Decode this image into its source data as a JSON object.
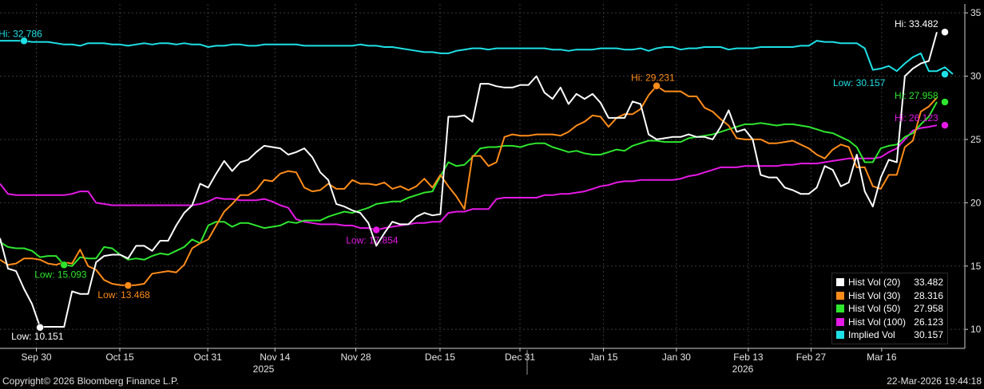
{
  "chart_data": {
    "type": "line",
    "x_ticks": [
      "Sep 30",
      "Oct 15",
      "Oct 31",
      "Nov 14",
      "Nov 28",
      "Dec 15",
      "Dec 31",
      "Jan 15",
      "Jan 30",
      "Feb 13",
      "Feb 27",
      "Mar 16"
    ],
    "x_years": [
      "2025",
      "2026"
    ],
    "y_ticks": [
      "10",
      "15",
      "20",
      "25",
      "30",
      "35"
    ],
    "ylim": [
      8.5,
      35.7
    ],
    "x_range": [
      0,
      118
    ],
    "grid": true,
    "legend_position": "bottom-right",
    "series": [
      {
        "name": "Hist Vol (20)",
        "color": "#ffffff",
        "last": "33.482",
        "values": [
          17.2,
          14.8,
          14.6,
          13.2,
          12.0,
          10.2,
          10.2,
          10.2,
          10.2,
          13.0,
          12.8,
          12.8,
          15.3,
          15.8,
          15.9,
          15.9,
          15.6,
          16.6,
          16.6,
          16.2,
          17.0,
          17.0,
          18.2,
          19.2,
          19.8,
          21.5,
          21.2,
          22.3,
          23.3,
          22.5,
          23.2,
          23.4,
          24.0,
          24.5,
          24.4,
          24.3,
          23.8,
          24.0,
          24.3,
          23.6,
          22.4,
          21.8,
          19.9,
          19.7,
          19.4,
          19.2,
          18.4,
          16.6,
          17.6,
          18.5,
          18.3,
          18.3,
          18.9,
          19.2,
          19.0,
          19.1,
          26.8,
          26.8,
          26.9,
          26.4,
          29.4,
          29.4,
          29.2,
          29.1,
          29.1,
          29.3,
          29.3,
          30.0,
          28.7,
          28.2,
          29.1,
          27.8,
          28.6,
          28.2,
          28.6,
          27.9,
          26.7,
          26.7,
          26.7,
          28.0,
          27.8,
          25.4,
          25.0,
          25.1,
          25.2,
          25.2,
          25.4,
          25.2,
          25.2,
          25.0,
          26.0,
          27.3,
          25.6,
          25.8,
          25.0,
          22.2,
          22.0,
          22.0,
          21.2,
          21.0,
          20.7,
          20.7,
          21.2,
          22.9,
          22.6,
          21.3,
          21.6,
          23.8,
          20.9,
          19.7,
          22.0,
          23.4,
          23.2,
          30.0,
          30.6,
          31.0,
          31.2,
          33.48
        ]
      },
      {
        "name": "Hist Vol (30)",
        "color": "#ff8c1a",
        "last": "28.316",
        "values": [
          15.5,
          15.1,
          15.2,
          15.6,
          15.6,
          15.5,
          15.2,
          15.1,
          15.3,
          15.2,
          16.3,
          15.0,
          14.7,
          13.9,
          13.6,
          13.5,
          13.47,
          13.5,
          13.6,
          14.4,
          14.5,
          14.6,
          14.5,
          15.1,
          16.4,
          16.8,
          17.1,
          18.2,
          19.3,
          19.9,
          20.6,
          20.6,
          21.0,
          21.8,
          21.7,
          22.3,
          22.5,
          22.4,
          21.2,
          20.9,
          21.0,
          21.5,
          21.1,
          21.1,
          21.8,
          21.5,
          21.5,
          21.4,
          21.6,
          21.1,
          21.3,
          21.0,
          21.3,
          21.9,
          21.2,
          22.2,
          21.3,
          20.5,
          19.5,
          23.7,
          23.7,
          22.9,
          23.2,
          25.2,
          25.4,
          25.3,
          25.3,
          25.4,
          25.4,
          25.4,
          25.3,
          25.6,
          26.1,
          26.4,
          26.9,
          26.8,
          26.0,
          26.7,
          27.0,
          27.0,
          27.4,
          28.5,
          29.23,
          28.8,
          28.8,
          28.8,
          28.4,
          28.4,
          27.5,
          27.2,
          26.6,
          26.1,
          25.1,
          25.0,
          25.0,
          25.0,
          24.7,
          24.7,
          24.8,
          24.9,
          24.6,
          24.3,
          23.8,
          23.5,
          24.2,
          24.6,
          24.4,
          22.8,
          22.8,
          21.3,
          21.1,
          22.2,
          22.2,
          24.4,
          24.9,
          27.2,
          27.6,
          28.3
        ]
      },
      {
        "name": "Hist Vol (50)",
        "color": "#2ee62e",
        "last": "27.958",
        "values": [
          16.9,
          16.5,
          16.4,
          16.4,
          16.2,
          15.7,
          15.8,
          15.8,
          15.1,
          15.0,
          15.7,
          15.6,
          15.6,
          16.5,
          16.4,
          15.9,
          15.5,
          15.6,
          15.5,
          15.8,
          16.0,
          15.9,
          16.2,
          16.5,
          17.1,
          16.8,
          18.2,
          18.5,
          18.5,
          18.1,
          18.4,
          18.4,
          18.2,
          18.0,
          18.1,
          18.2,
          18.5,
          18.4,
          18.6,
          18.6,
          18.6,
          18.9,
          19.1,
          19.3,
          19.2,
          19.4,
          19.6,
          19.9,
          20.0,
          20.1,
          20.1,
          20.4,
          20.6,
          20.8,
          20.9,
          22.1,
          23.2,
          22.9,
          23.0,
          23.6,
          24.3,
          24.4,
          24.4,
          24.5,
          24.5,
          24.4,
          24.6,
          24.7,
          24.7,
          24.4,
          24.2,
          24.0,
          24.1,
          23.9,
          23.8,
          23.8,
          24.0,
          24.2,
          24.1,
          24.5,
          24.7,
          24.9,
          24.9,
          24.8,
          24.8,
          24.8,
          25.1,
          25.2,
          25.3,
          25.4,
          25.6,
          25.8,
          26.0,
          26.2,
          26.2,
          26.3,
          26.2,
          26.1,
          26.2,
          26.2,
          26.1,
          26.0,
          25.8,
          25.6,
          25.5,
          25.2,
          24.9,
          24.4,
          23.2,
          23.2,
          24.3,
          24.5,
          24.6,
          25.2,
          25.5,
          26.2,
          26.8,
          27.96
        ]
      },
      {
        "name": "Hist Vol (100)",
        "color": "#e619e6",
        "last": "26.123",
        "values": [
          21.5,
          20.7,
          20.6,
          20.6,
          20.6,
          20.6,
          20.6,
          20.6,
          20.6,
          20.7,
          20.9,
          20.9,
          20.0,
          19.9,
          19.8,
          19.8,
          19.8,
          19.8,
          19.8,
          19.8,
          19.8,
          19.8,
          19.8,
          19.8,
          19.8,
          19.9,
          20.1,
          20.4,
          20.3,
          20.3,
          20.2,
          20.2,
          20.2,
          20.3,
          20.1,
          19.8,
          19.6,
          18.7,
          18.5,
          18.4,
          18.3,
          18.3,
          18.3,
          18.2,
          18.2,
          18.0,
          18.0,
          17.85,
          18.0,
          18.1,
          18.2,
          18.3,
          18.4,
          18.4,
          18.5,
          18.5,
          19.2,
          19.3,
          19.3,
          19.5,
          19.5,
          19.5,
          20.3,
          20.4,
          20.4,
          20.4,
          20.4,
          20.4,
          20.6,
          20.6,
          20.7,
          20.7,
          20.8,
          20.9,
          21.1,
          21.3,
          21.4,
          21.6,
          21.7,
          21.7,
          21.8,
          21.8,
          21.8,
          21.8,
          21.8,
          21.9,
          22.1,
          22.2,
          22.4,
          22.6,
          22.8,
          22.8,
          22.8,
          22.9,
          22.9,
          22.9,
          22.9,
          22.9,
          23.0,
          23.0,
          23.1,
          23.1,
          23.1,
          23.2,
          23.3,
          23.4,
          23.5,
          23.5,
          23.5,
          23.5,
          23.6,
          24.0,
          24.3,
          25.0,
          25.7,
          25.9,
          26.0,
          26.12
        ]
      },
      {
        "name": "Implied Vol",
        "color": "#1ee0e6",
        "last": "30.157",
        "values": [
          32.8,
          32.8,
          32.8,
          32.79,
          32.7,
          32.7,
          32.7,
          32.6,
          32.5,
          32.5,
          32.4,
          32.6,
          32.6,
          32.6,
          32.5,
          32.5,
          32.4,
          32.5,
          32.6,
          32.5,
          32.6,
          32.6,
          32.5,
          32.6,
          32.5,
          32.5,
          32.3,
          32.4,
          32.4,
          32.5,
          32.5,
          32.4,
          32.4,
          32.5,
          32.5,
          32.5,
          32.5,
          32.5,
          32.4,
          32.4,
          32.4,
          32.4,
          32.4,
          32.4,
          32.4,
          32.5,
          32.4,
          32.4,
          32.3,
          32.3,
          32.2,
          32.1,
          32.0,
          31.9,
          31.9,
          31.8,
          31.8,
          32.0,
          32.1,
          32.2,
          32.2,
          32.1,
          32.2,
          32.2,
          32.2,
          32.2,
          32.2,
          32.2,
          32.2,
          32.1,
          32.1,
          32.0,
          32.1,
          32.1,
          32.1,
          32.2,
          32.2,
          32.2,
          32.1,
          32.1,
          32.2,
          32.0,
          32.2,
          32.3,
          32.3,
          32.1,
          32.2,
          32.2,
          32.3,
          32.3,
          32.3,
          32.1,
          32.2,
          32.2,
          32.2,
          32.3,
          32.3,
          32.3,
          32.3,
          32.3,
          32.4,
          32.4,
          32.8,
          32.7,
          32.7,
          32.6,
          32.6,
          32.6,
          32.2,
          30.5,
          30.6,
          30.8,
          30.4,
          31.0,
          31.5,
          31.8,
          30.4,
          30.4,
          30.7,
          30.16
        ]
      }
    ],
    "annotations": [
      {
        "text": "Hi: 32.786",
        "color": "#1ee0e6",
        "x": 3,
        "y": 32.786
      },
      {
        "text": "Hi: 33.482",
        "color": "#ffffff",
        "x": 118,
        "y": 33.482
      },
      {
        "text": "Hi: 29.231",
        "color": "#ff8c1a",
        "x": 82,
        "y": 29.231
      },
      {
        "text": "Hi: 27.958",
        "color": "#2ee62e",
        "x": 118,
        "y": 27.958
      },
      {
        "text": "Hi: 26.123",
        "color": "#e619e6",
        "x": 118,
        "y": 26.123
      },
      {
        "text": "Low: 30.157",
        "color": "#1ee0e6",
        "x": 118,
        "y": 30.157
      },
      {
        "text": "Low: 10.151",
        "color": "#ffffff",
        "x": 5,
        "y": 10.151
      },
      {
        "text": "Low: 15.093",
        "color": "#2ee62e",
        "x": 8,
        "y": 15.093
      },
      {
        "text": "Low: 13.468",
        "color": "#ff8c1a",
        "x": 16,
        "y": 13.468
      },
      {
        "text": "Low: 17.854",
        "color": "#e619e6",
        "x": 47,
        "y": 17.854
      }
    ]
  },
  "footer": {
    "copyright": "Copyright© 2026 Bloomberg Finance L.P.",
    "timestamp": "22-Mar-2026 19:44:18"
  }
}
